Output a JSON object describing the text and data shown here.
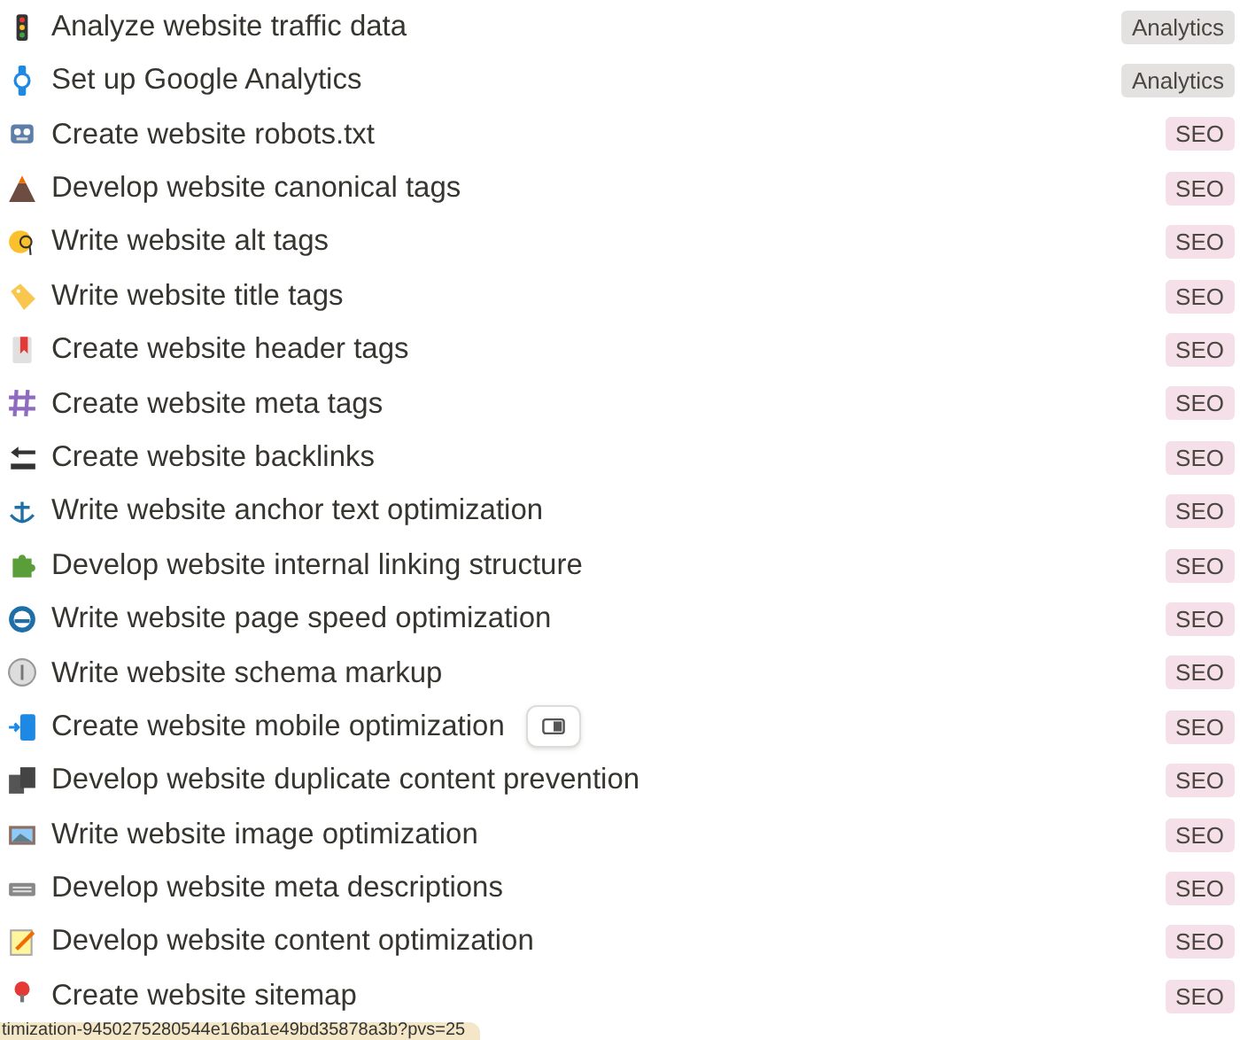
{
  "rows": [
    {
      "title": "Analyze website traffic data",
      "tag": {
        "label": "Analytics",
        "color": "#e3e2e0"
      }
    },
    {
      "title": "Set up Google Analytics",
      "tag": {
        "label": "Analytics",
        "color": "#e3e2e0"
      }
    },
    {
      "title": "Create website robots.txt",
      "tag": {
        "label": "SEO",
        "color": "#f5e0e9"
      }
    },
    {
      "title": "Develop website canonical tags",
      "tag": {
        "label": "SEO",
        "color": "#f5e0e9"
      }
    },
    {
      "title": "Write website alt tags",
      "tag": {
        "label": "SEO",
        "color": "#f5e0e9"
      }
    },
    {
      "title": "Write website title tags",
      "tag": {
        "label": "SEO",
        "color": "#f5e0e9"
      }
    },
    {
      "title": "Create website header tags",
      "tag": {
        "label": "SEO",
        "color": "#f5e0e9"
      }
    },
    {
      "title": "Create website meta tags",
      "tag": {
        "label": "SEO",
        "color": "#f5e0e9"
      }
    },
    {
      "title": "Create website backlinks",
      "tag": {
        "label": "SEO",
        "color": "#f5e0e9"
      }
    },
    {
      "title": "Write website anchor text optimization",
      "tag": {
        "label": "SEO",
        "color": "#f5e0e9"
      }
    },
    {
      "title": "Develop website internal linking structure",
      "tag": {
        "label": "SEO",
        "color": "#f5e0e9"
      }
    },
    {
      "title": "Write website page speed optimization",
      "tag": {
        "label": "SEO",
        "color": "#f5e0e9"
      }
    },
    {
      "title": "Write website schema markup",
      "tag": {
        "label": "SEO",
        "color": "#f5e0e9"
      }
    },
    {
      "title": "Create website mobile optimization",
      "tag": {
        "label": "SEO",
        "color": "#f5e0e9"
      },
      "hovered": true
    },
    {
      "title": "Develop website duplicate content prevention",
      "tag": {
        "label": "SEO",
        "color": "#f5e0e9"
      }
    },
    {
      "title": "Write website image optimization",
      "tag": {
        "label": "SEO",
        "color": "#f5e0e9"
      }
    },
    {
      "title": "Develop website meta descriptions",
      "tag": {
        "label": "SEO",
        "color": "#f5e0e9"
      }
    },
    {
      "title": "Develop website content optimization",
      "tag": {
        "label": "SEO",
        "color": "#f5e0e9"
      }
    },
    {
      "title": "Create website sitemap",
      "tag": {
        "label": "SEO",
        "color": "#f5e0e9"
      }
    }
  ],
  "status_url": "timization-9450275280544e16ba1e49bd35878a3b?pvs=25"
}
